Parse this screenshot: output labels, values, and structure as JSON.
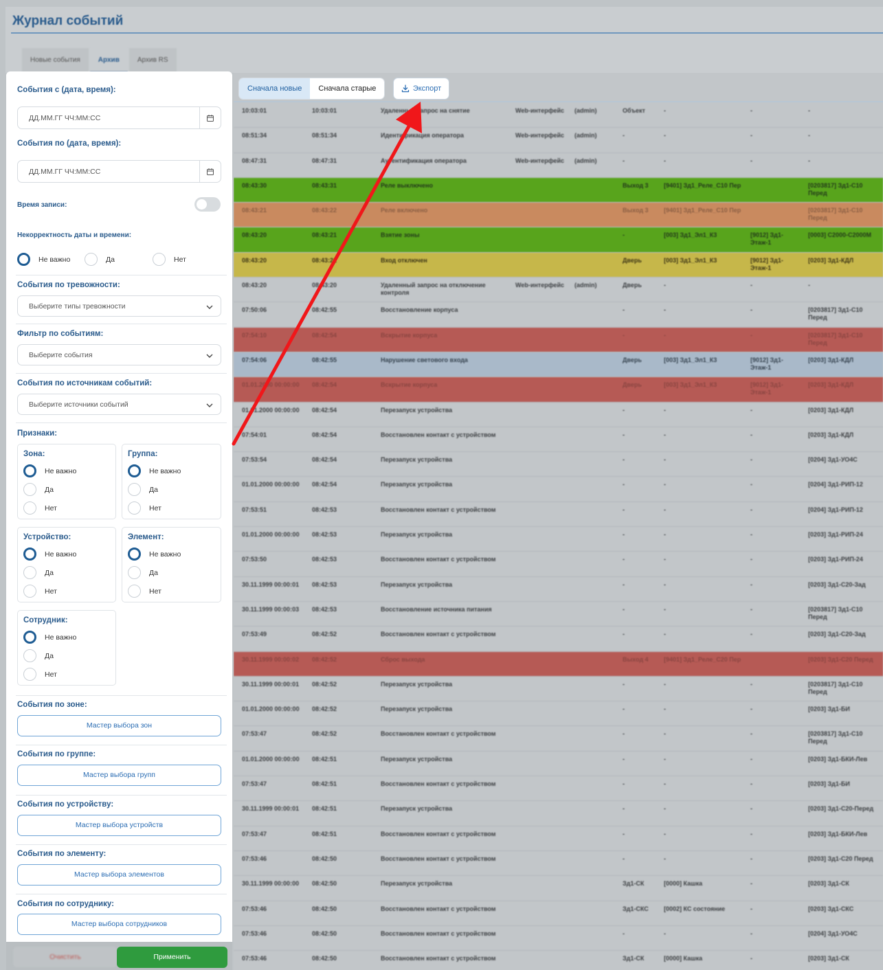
{
  "app_title": "Журнал событий",
  "tabs": [
    "Новые события",
    "Архив",
    "Архив RS"
  ],
  "toolbar": {
    "sort_newest": "Сначала новые",
    "sort_oldest": "Сначала старые",
    "export": "Экспорт"
  },
  "filters": {
    "date_from_label": "События с (дата, время):",
    "date_from_placeholder": "ДД.ММ.ГГ ЧЧ:ММ:СС",
    "date_to_label": "События по (дата, время):",
    "date_to_placeholder": "ДД.ММ.ГГ ЧЧ:ММ:СС",
    "record_time_label": "Время записи:",
    "datetime_incorrect_label": "Некорректность даты и времени:",
    "opt_any": "Не важно",
    "opt_yes": "Да",
    "opt_no": "Нет",
    "alarm_label": "События по тревожности:",
    "alarm_placeholder": "Выберите типы тревожности",
    "events_label": "Фильтр по событиям:",
    "events_placeholder": "Выберите события",
    "sources_label": "События по источникам событий:",
    "sources_placeholder": "Выберите источники событий",
    "attributes_label": "Признаки:",
    "zone_label": "Зона:",
    "group_label": "Группа:",
    "device_label": "Устройство:",
    "element_label": "Элемент:",
    "employee_label": "Сотрудник:",
    "by_zone_label": "События по зоне:",
    "by_zone_button": "Мастер выбора зон",
    "by_group_label": "События по группе:",
    "by_group_button": "Мастер выбора групп",
    "by_device_label": "События по устройству:",
    "by_device_button": "Мастер выбора устройств",
    "by_element_label": "События по элементу:",
    "by_element_button": "Мастер выбора элементов",
    "by_employee_label": "События по сотруднику:",
    "by_employee_button": "Мастер выбора сотрудников",
    "reset_button": "Очистить",
    "apply_button": "Применить"
  },
  "table": {
    "rows": [
      {
        "color": "none",
        "cells": [
          "10:03:01",
          "10:03:01",
          "Удаленный запрос на снятие",
          "Web-интерфейс",
          "(admin)",
          "Объект",
          "-",
          "-",
          "-"
        ]
      },
      {
        "color": "none",
        "cells": [
          "08:51:34",
          "08:51:34",
          "Идентификация оператора",
          "Web-интерфейс",
          "(admin)",
          "-",
          "-",
          "-",
          "-"
        ]
      },
      {
        "color": "none",
        "cells": [
          "08:47:31",
          "08:47:31",
          "Аутентификация оператора",
          "Web-интерфейс",
          "(admin)",
          "-",
          "-",
          "-",
          "-"
        ]
      },
      {
        "color": "green",
        "cells": [
          "08:43:30",
          "08:43:31",
          "Реле выключено",
          "",
          "",
          "Выход 3",
          "[9401] Зд1_Реле_С10 Пер",
          "",
          "[0203817] Зд1-С10 Перед"
        ]
      },
      {
        "color": "orange",
        "cells": [
          "08:43:21",
          "08:43:22",
          "Реле включено",
          "",
          "",
          "Выход 3",
          "[9401] Зд1_Реле_С10 Пер",
          "",
          "[0203817] Зд1-С10 Перед"
        ]
      },
      {
        "color": "green",
        "cells": [
          "08:43:20",
          "08:43:21",
          "Взятие зоны",
          "",
          "",
          "-",
          "[003] Зд1_Эл1_К3",
          "[9012] Зд1-Этаж-1",
          "[0003] С2000-С2000М"
        ]
      },
      {
        "color": "yellow",
        "cells": [
          "08:43:20",
          "08:43:21",
          "Вход отключен",
          "",
          "",
          "Дверь",
          "[003] Зд1_Эл1_К3",
          "[9012] Зд1-Этаж-1",
          "[0203] Зд1-КДЛ"
        ]
      },
      {
        "color": "none",
        "cells": [
          "08:43:20",
          "08:43:20",
          "Удаленный запрос на отключение контроля",
          "Web-интерфейс",
          "(admin)",
          "Дверь",
          "-",
          "-",
          "-"
        ]
      },
      {
        "color": "none",
        "cells": [
          "07:50:06",
          "08:42:55",
          "Восстановление корпуса",
          "",
          "",
          "-",
          "-",
          "-",
          "[0203817] Зд1-С10 Перед"
        ]
      },
      {
        "color": "red",
        "cells": [
          "07:54:10",
          "08:42:54",
          "Вскрытие корпуса",
          "",
          "",
          "-",
          "-",
          "-",
          "[0203817] Зд1-С10 Перед"
        ]
      },
      {
        "color": "blue",
        "cells": [
          "07:54:06",
          "08:42:55",
          "Нарушение светового входа",
          "",
          "",
          "Дверь",
          "[003] Зд1_Эл1_К3",
          "[9012] Зд1-Этаж-1",
          "[0203] Зд1-КДЛ"
        ]
      },
      {
        "color": "red",
        "cells": [
          "01.01.2000 00:00:00",
          "08:42:54",
          "Вскрытие корпуса",
          "",
          "",
          "Дверь",
          "[003] Зд1_Эл1_К3",
          "[9012] Зд1-Этаж-1",
          "[0203] Зд1-КДЛ"
        ]
      },
      {
        "color": "none",
        "cells": [
          "01.01.2000 00:00:00",
          "08:42:54",
          "Перезапуск устройства",
          "",
          "",
          "-",
          "-",
          "-",
          "[0203] Зд1-КДЛ"
        ]
      },
      {
        "color": "none",
        "cells": [
          "07:54:01",
          "08:42:54",
          "Восстановлен контакт с устройством",
          "",
          "",
          "-",
          "-",
          "-",
          "[0203] Зд1-КДЛ"
        ]
      },
      {
        "color": "none",
        "cells": [
          "07:53:54",
          "08:42:54",
          "Перезапуск устройства",
          "",
          "",
          "-",
          "-",
          "-",
          "[0204] Зд1-УО4С"
        ]
      },
      {
        "color": "none",
        "cells": [
          "01.01.2000 00:00:00",
          "08:42:54",
          "Перезапуск устройства",
          "",
          "",
          "-",
          "-",
          "-",
          "[0204] Зд1-РИП-12"
        ]
      },
      {
        "color": "none",
        "cells": [
          "07:53:51",
          "08:42:53",
          "Восстановлен контакт с устройством",
          "",
          "",
          "-",
          "-",
          "-",
          "[0204] Зд1-РИП-12"
        ]
      },
      {
        "color": "none",
        "cells": [
          "01.01.2000 00:00:00",
          "08:42:53",
          "Перезапуск устройства",
          "",
          "",
          "-",
          "-",
          "-",
          "[0203] Зд1-РИП-24"
        ]
      },
      {
        "color": "none",
        "cells": [
          "07:53:50",
          "08:42:53",
          "Восстановлен контакт с устройством",
          "",
          "",
          "-",
          "-",
          "-",
          "[0203] Зд1-РИП-24"
        ]
      },
      {
        "color": "none",
        "cells": [
          "30.11.1999 00:00:01",
          "08:42:53",
          "Перезапуск устройства",
          "",
          "",
          "-",
          "-",
          "-",
          "[0203] Зд1-С20-Зад"
        ]
      },
      {
        "color": "none",
        "cells": [
          "30.11.1999 00:00:03",
          "08:42:53",
          "Восстановление источника питания",
          "",
          "",
          "-",
          "-",
          "-",
          "[0203817] Зд1-С10 Перед"
        ]
      },
      {
        "color": "none",
        "cells": [
          "07:53:49",
          "08:42:52",
          "Восстановлен контакт с устройством",
          "",
          "",
          "-",
          "-",
          "-",
          "[0203] Зд1-С20-Зад"
        ]
      },
      {
        "color": "red",
        "cells": [
          "30.11.1999 00:00:02",
          "08:42:52",
          "Сброс выхода",
          "",
          "",
          "Выход 4",
          "[9401] Зд1_Реле_С20 Пер",
          "",
          "[0203] Зд1-С20 Перед"
        ]
      },
      {
        "color": "none",
        "cells": [
          "30.11.1999 00:00:01",
          "08:42:52",
          "Перезапуск устройства",
          "",
          "",
          "-",
          "-",
          "-",
          "[0203817] Зд1-С10 Перед"
        ]
      },
      {
        "color": "none",
        "cells": [
          "01.01.2000 00:00:00",
          "08:42:52",
          "Перезапуск устройства",
          "",
          "",
          "-",
          "-",
          "-",
          "[0203] Зд1-БИ"
        ]
      },
      {
        "color": "none",
        "cells": [
          "07:53:47",
          "08:42:52",
          "Восстановлен контакт с устройством",
          "",
          "",
          "-",
          "-",
          "-",
          "[0203817] Зд1-С10 Перед"
        ]
      },
      {
        "color": "none",
        "cells": [
          "01.01.2000 00:00:00",
          "08:42:51",
          "Перезапуск устройства",
          "",
          "",
          "-",
          "-",
          "-",
          "[0203] Зд1-БКИ-Лев"
        ]
      },
      {
        "color": "none",
        "cells": [
          "07:53:47",
          "08:42:51",
          "Восстановлен контакт с устройством",
          "",
          "",
          "-",
          "-",
          "-",
          "[0203] Зд1-БИ"
        ]
      },
      {
        "color": "none",
        "cells": [
          "30.11.1999 00:00:01",
          "08:42:51",
          "Перезапуск устройства",
          "",
          "",
          "-",
          "-",
          "-",
          "[0203] Зд1-С20-Перед"
        ]
      },
      {
        "color": "none",
        "cells": [
          "07:53:47",
          "08:42:51",
          "Восстановлен контакт с устройством",
          "",
          "",
          "-",
          "-",
          "-",
          "[0203] Зд1-БКИ-Лев"
        ]
      },
      {
        "color": "none",
        "cells": [
          "07:53:46",
          "08:42:50",
          "Восстановлен контакт с устройством",
          "",
          "",
          "-",
          "-",
          "-",
          "[0203] Зд1-С20 Перед"
        ]
      },
      {
        "color": "none",
        "cells": [
          "30.11.1999 00:00:00",
          "08:42:50",
          "Перезапуск устройства",
          "",
          "",
          "Зд1-СК",
          "[0000] Кашка",
          "-",
          "[0203] Зд1-СК"
        ]
      },
      {
        "color": "none",
        "cells": [
          "07:53:46",
          "08:42:50",
          "Восстановлен контакт с устройством",
          "",
          "",
          "Зд1-СКС",
          "[0002] КС состояние",
          "-",
          "[0203] Зд1-СКС"
        ]
      },
      {
        "color": "none",
        "cells": [
          "07:53:46",
          "08:42:50",
          "Восстановлен контакт с устройством",
          "",
          "",
          "-",
          "-",
          "-",
          "[0204] Зд1-УО4С"
        ]
      },
      {
        "color": "none",
        "cells": [
          "07:53:46",
          "08:42:50",
          "Восстановлен контакт с устройством",
          "",
          "",
          "Зд1-СК",
          "[0000] Кашка",
          "-",
          "[0203] Зд1-СК"
        ]
      }
    ]
  }
}
